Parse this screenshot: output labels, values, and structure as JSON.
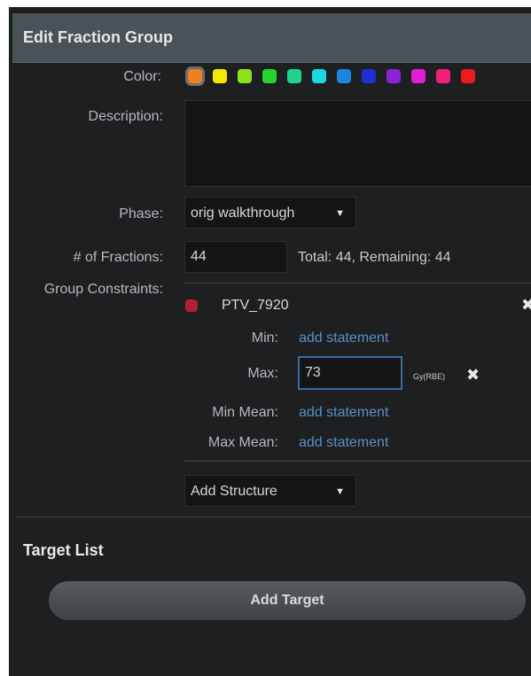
{
  "header": {
    "title": "Edit Fraction Group"
  },
  "form": {
    "color_label": "Color:",
    "colors": [
      "#f07f1e",
      "#f5e800",
      "#8be21a",
      "#27d42b",
      "#1ed48c",
      "#1ad7e0",
      "#1b86e0",
      "#1f2fd6",
      "#8a22d8",
      "#e41ed6",
      "#f0207a",
      "#ec1b1b"
    ],
    "selected_color": "#f07f1e",
    "description_label": "Description:",
    "description_value": "",
    "phase_label": "Phase:",
    "phase_value": "orig walkthrough",
    "fractions_label": "# of Fractions:",
    "fractions_value": "44",
    "fractions_summary": "Total: 44, Remaining: 44",
    "group_constraints_label": "Group Constraints:"
  },
  "constraint": {
    "structure_name": "PTV_7920",
    "structure_color": "#b3202e",
    "min_label": "Min:",
    "min_link": "add statement",
    "max_label": "Max:",
    "max_value": "73",
    "max_unit": "Gy(RBE)",
    "min_mean_label": "Min Mean:",
    "min_mean_link": "add statement",
    "max_mean_label": "Max Mean:",
    "max_mean_link": "add statement",
    "add_structure_label": "Add Structure"
  },
  "target_list": {
    "title": "Target List",
    "add_button_label": "Add Target"
  },
  "icons": {
    "remove": "close-icon",
    "dropdown": "caret-down-icon"
  }
}
